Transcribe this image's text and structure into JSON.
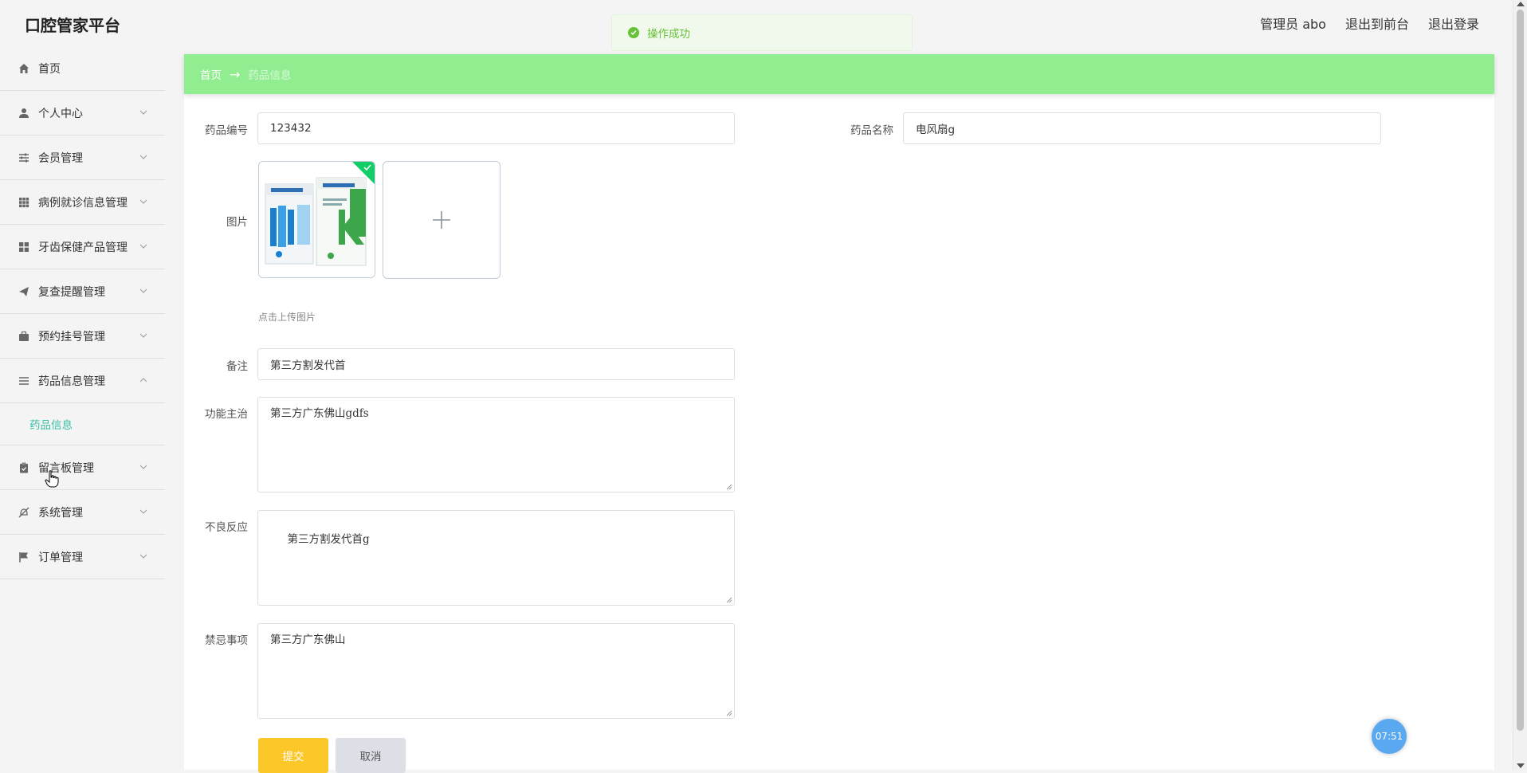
{
  "app": {
    "title": "口腔管家平台"
  },
  "header": {
    "admin": "管理员 abo",
    "to_frontend": "退出到前台",
    "logout": "退出登录"
  },
  "toast": {
    "text": "操作成功",
    "color": "#67c23a"
  },
  "sidebar": {
    "items": [
      {
        "label": "首页",
        "icon": "home-icon"
      },
      {
        "label": "个人中心",
        "icon": "user-icon"
      },
      {
        "label": "会员管理",
        "icon": "sliders-icon"
      },
      {
        "label": "病例就诊信息管理",
        "icon": "grid-icon"
      },
      {
        "label": "牙齿保健产品管理",
        "icon": "apps-icon"
      },
      {
        "label": "复查提醒管理",
        "icon": "send-icon"
      },
      {
        "label": "预约挂号管理",
        "icon": "briefcase-icon"
      },
      {
        "label": "药品信息管理",
        "icon": "menu-icon",
        "expanded": true
      },
      {
        "label": "留言板管理",
        "icon": "clipboard-icon"
      },
      {
        "label": "系统管理",
        "icon": "bell-off-icon"
      },
      {
        "label": "订单管理",
        "icon": "flag-icon"
      }
    ],
    "submenu": {
      "label": "药品信息",
      "color": "#3bbfa5"
    }
  },
  "breadcrumb": {
    "home": "首页",
    "separator": "→",
    "current": "药品信息",
    "background": "#90ee90"
  },
  "form": {
    "code_label": "药品编号",
    "code_value": "123432",
    "name_label": "药品名称",
    "name_value": "电风扇g",
    "image_label": "图片",
    "upload_tip": "点击上传图片",
    "remark_label": "备注",
    "remark_value": "第三方割发代首",
    "function_label": "功能主治",
    "function_value": "第三方广东佛山gdfs",
    "adverse_label": "不良反应",
    "adverse_value": " 第三方割发代首g",
    "taboo_label": "禁忌事项",
    "taboo_value": "第三方广东佛山",
    "submit": "提交",
    "cancel": "取消"
  },
  "timer": "07:51",
  "colors": {
    "submit": "#fcc728",
    "cancel": "#dcdfe6"
  }
}
